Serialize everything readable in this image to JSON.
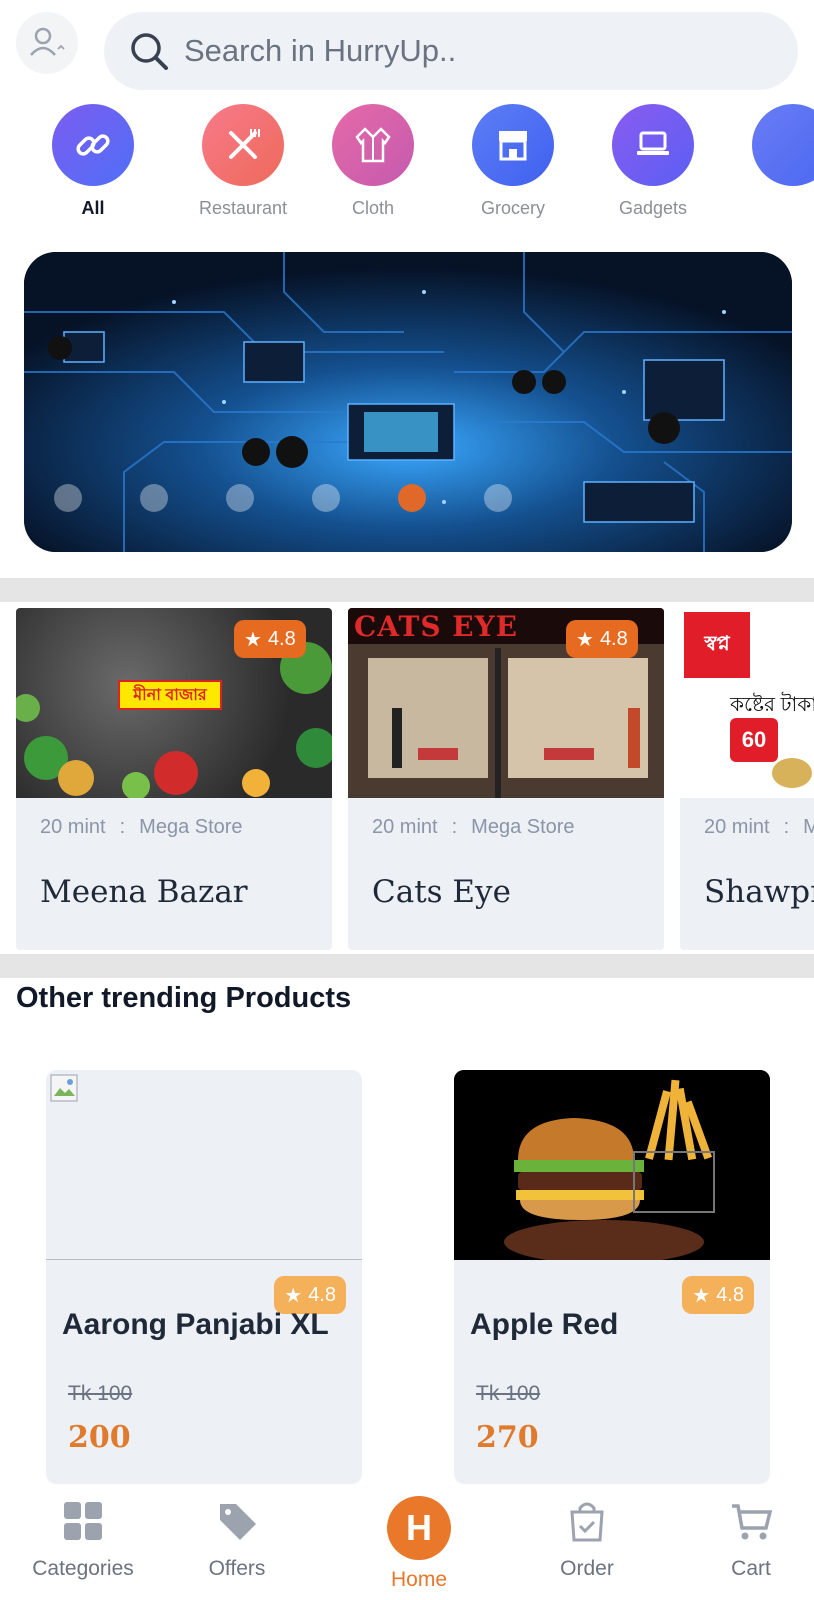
{
  "header": {
    "search_placeholder": "Search in HurryUp.."
  },
  "categories": [
    {
      "label": "All",
      "icon": "link-icon",
      "active": true
    },
    {
      "label": "Restaurant",
      "icon": "fork-knife-icon"
    },
    {
      "label": "Cloth",
      "icon": "robe-icon"
    },
    {
      "label": "Grocery",
      "icon": "store-icon"
    },
    {
      "label": "Gadgets",
      "icon": "laptop-icon"
    }
  ],
  "banner": {
    "slides": 6,
    "active_slide": 5
  },
  "stores": [
    {
      "rating": "4.8",
      "time": "20 mint",
      "separator": ":",
      "type": "Mega Store",
      "name": "Meena Bazar",
      "logo_text": "মীনা বাজার"
    },
    {
      "rating": "4.8",
      "time": "20 mint",
      "separator": ":",
      "type": "Mega Store",
      "name": "Cats Eye",
      "sign_text": "CATS EYE"
    },
    {
      "rating": "4.8",
      "time": "20 mint",
      "separator": ":",
      "type": "Mega Store",
      "name": "Shawpno",
      "sign_text": "স্বপ্ন",
      "promo_text": "কষ্টের টাকা",
      "price_tag": "60"
    }
  ],
  "section_title": "Other trending Products",
  "products": [
    {
      "name": "Aarong Panjabi XL",
      "rating": "4.8",
      "old_price": "Tk 100",
      "price": "200"
    },
    {
      "name": "Apple Red",
      "rating": "4.8",
      "old_price": "Tk 100",
      "price": "270"
    }
  ],
  "nav": {
    "categories": "Categories",
    "offers": "Offers",
    "home": "Home",
    "home_letter": "H",
    "order": "Order",
    "cart": "Cart"
  },
  "colors": {
    "accent": "#e9782a",
    "card_bg": "#edf1f6",
    "rating_bg": "#e66a1f"
  }
}
